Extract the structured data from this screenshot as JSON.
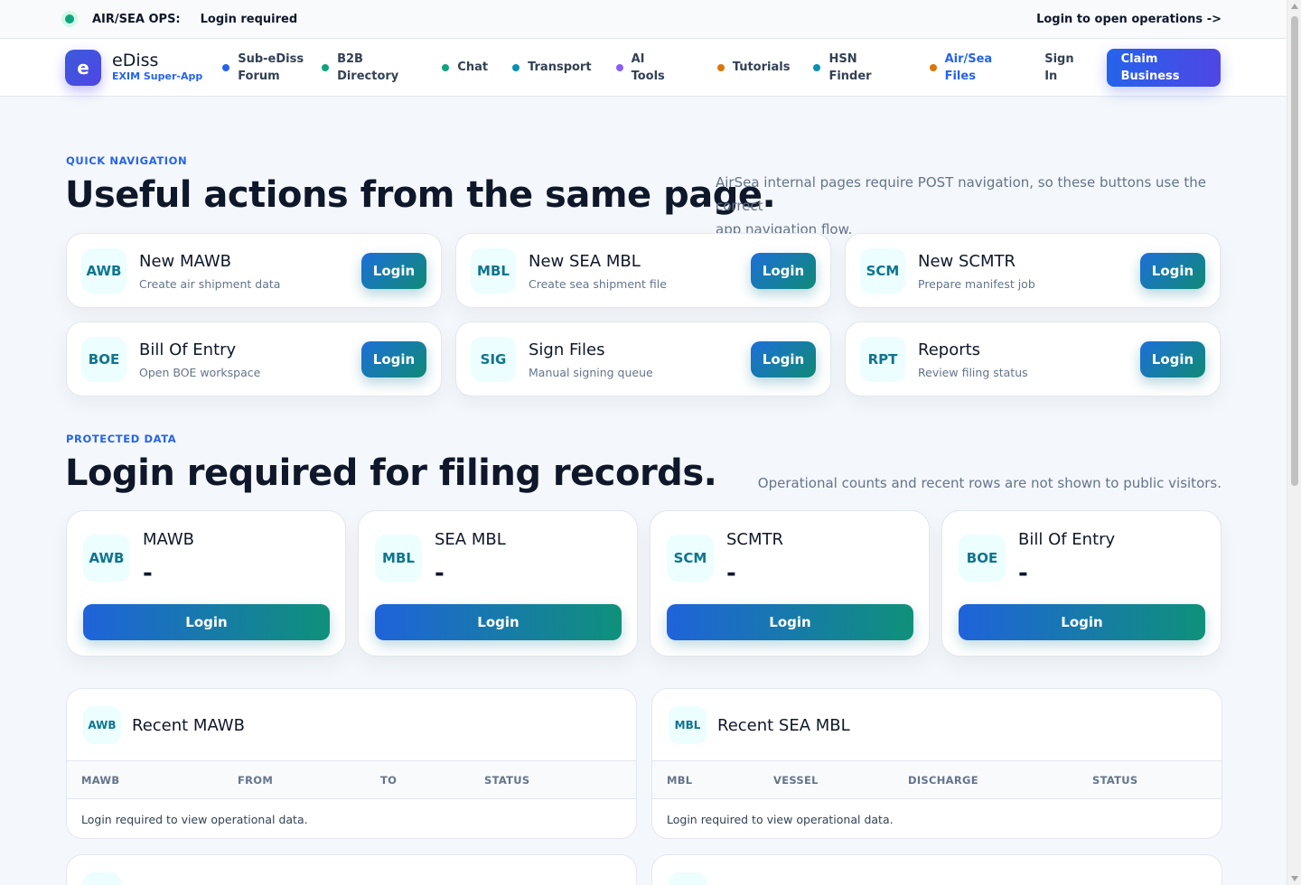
{
  "topbar": {
    "ops_label": "AIR/SEA OPS:",
    "status": "Login required",
    "cta": "Login to open operations ->"
  },
  "brand": {
    "logo_letter": "e",
    "name": "eDiss",
    "tagline": "EXIM Super-App"
  },
  "nav": {
    "items": [
      {
        "label_1": "Sub-eDiss",
        "label_2": "Forum",
        "dot_color": "#2563eb"
      },
      {
        "label_1": "B2B",
        "label_2": "Directory",
        "dot_color": "#10a37f"
      },
      {
        "label_1": "Chat",
        "label_2": "",
        "dot_color": "#10a37f"
      },
      {
        "label_1": "Transport",
        "label_2": "",
        "dot_color": "#0891b2"
      },
      {
        "label_1": "AI",
        "label_2": "Tools",
        "dot_color": "#8b5cf6"
      },
      {
        "label_1": "Tutorials",
        "label_2": "",
        "dot_color": "#d97706"
      },
      {
        "label_1": "HSN",
        "label_2": "Finder",
        "dot_color": "#0891b2"
      },
      {
        "label_1": "Air/Sea",
        "label_2": "Files",
        "dot_color": "#d97706"
      }
    ],
    "signin_1": "Sign",
    "signin_2": "In",
    "claim_1": "Claim",
    "claim_2": "Business"
  },
  "quick_nav": {
    "eyebrow": "QUICK NAVIGATION",
    "title": "Useful actions from the same page.",
    "note_1": "AirSea internal pages require POST navigation, so these buttons use the correct",
    "note_2": "app navigation flow.",
    "cards": [
      {
        "code": "AWB",
        "title": "New MAWB",
        "desc": "Create air shipment data",
        "button": "Login"
      },
      {
        "code": "MBL",
        "title": "New SEA MBL",
        "desc": "Create sea shipment file",
        "button": "Login"
      },
      {
        "code": "SCM",
        "title": "New SCMTR",
        "desc": "Prepare manifest job",
        "button": "Login"
      },
      {
        "code": "BOE",
        "title": "Bill Of Entry",
        "desc": "Open BOE workspace",
        "button": "Login"
      },
      {
        "code": "SIG",
        "title": "Sign Files",
        "desc": "Manual signing queue",
        "button": "Login"
      },
      {
        "code": "RPT",
        "title": "Reports",
        "desc": "Review filing status",
        "button": "Login"
      }
    ]
  },
  "protected": {
    "eyebrow": "PROTECTED DATA",
    "title": "Login required for filing records.",
    "note": "Operational counts and recent rows are not shown to public visitors.",
    "stats": [
      {
        "code": "AWB",
        "title": "MAWB",
        "value": "-",
        "button": "Login"
      },
      {
        "code": "MBL",
        "title": "SEA MBL",
        "value": "-",
        "button": "Login"
      },
      {
        "code": "SCM",
        "title": "SCMTR",
        "value": "-",
        "button": "Login"
      },
      {
        "code": "BOE",
        "title": "Bill Of Entry",
        "value": "-",
        "button": "Login"
      }
    ]
  },
  "recent": [
    {
      "code": "AWB",
      "title": "Recent MAWB",
      "columns": [
        "MAWB",
        "FROM",
        "TO",
        "STATUS"
      ],
      "empty": "Login required to view operational data."
    },
    {
      "code": "MBL",
      "title": "Recent SEA MBL",
      "columns": [
        "MBL",
        "VESSEL",
        "DISCHARGE",
        "STATUS"
      ],
      "empty": "Login required to view operational data."
    }
  ],
  "colors": {
    "accent": "#2563eb",
    "teal": "#0e7490",
    "badge_bg": "#ecfeff",
    "status_dot": "#10a37f"
  }
}
